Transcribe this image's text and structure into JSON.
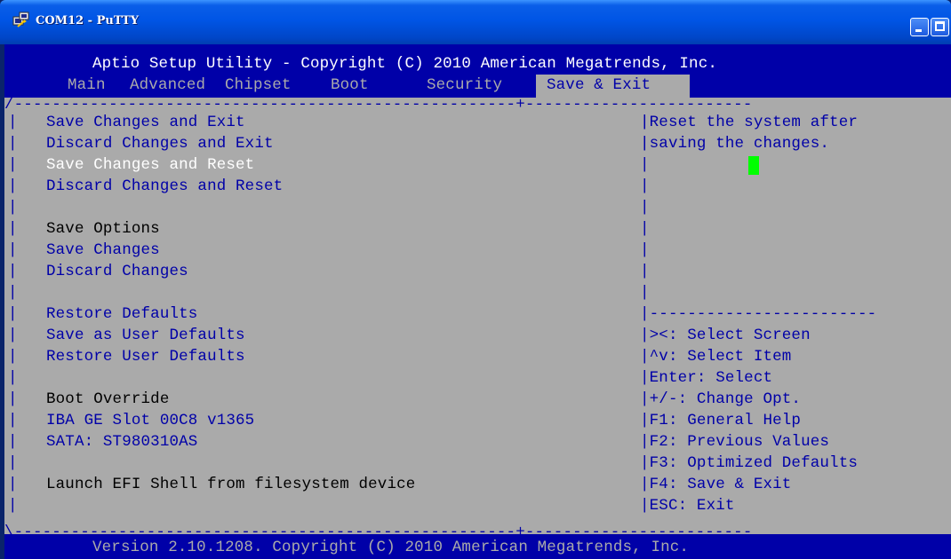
{
  "window": {
    "title": "COM12 - PuTTY"
  },
  "bios": {
    "header": "Aptio Setup Utility - Copyright (C) 2010 American Megatrends, Inc.",
    "tabs": [
      "Main",
      "Advanced",
      "Chipset",
      "Boot",
      "Security"
    ],
    "active_tab": "Save & Exit",
    "top_border": "/-----------------------------------------------------+------------------------",
    "bottom_border": "\\-----------------------------------------------------+------------------------",
    "menu": {
      "items": [
        {
          "label": "Save Changes and Exit",
          "style": "normal"
        },
        {
          "label": "Discard Changes and Exit",
          "style": "normal"
        },
        {
          "label": "Save Changes and Reset",
          "style": "selected"
        },
        {
          "label": "Discard Changes and Reset",
          "style": "normal"
        },
        {
          "label": "Save Options",
          "style": "heading"
        },
        {
          "label": "Save Changes",
          "style": "normal"
        },
        {
          "label": "Discard Changes",
          "style": "normal"
        },
        {
          "label": "Restore Defaults",
          "style": "normal"
        },
        {
          "label": "Save as User Defaults",
          "style": "normal"
        },
        {
          "label": "Restore User Defaults",
          "style": "normal"
        },
        {
          "label": "Boot Override",
          "style": "heading"
        },
        {
          "label": "IBA GE Slot 00C8 v1365",
          "style": "normal"
        },
        {
          "label": "SATA: ST980310AS",
          "style": "normal"
        },
        {
          "label": "Launch EFI Shell from filesystem device",
          "style": "heading"
        }
      ]
    },
    "help": {
      "line1": "Reset the system after",
      "line2": "saving the changes.",
      "separator": "------------------------"
    },
    "keys": [
      "><: Select Screen",
      "^v: Select Item",
      "Enter: Select",
      "+/-: Change Opt.",
      "F1: General Help",
      "F2: Previous Values",
      "F3: Optimized Defaults",
      "F4: Save & Exit",
      "ESC: Exit"
    ],
    "border_char": "|",
    "footer": "Version 2.10.1208. Copyright (C) 2010 American Megatrends, Inc."
  },
  "colors": {
    "bios_blue": "#0000A8",
    "bios_grey": "#AAAAAA",
    "cursor_green": "#00FF00",
    "titlebar_blue": "#0055E5"
  }
}
